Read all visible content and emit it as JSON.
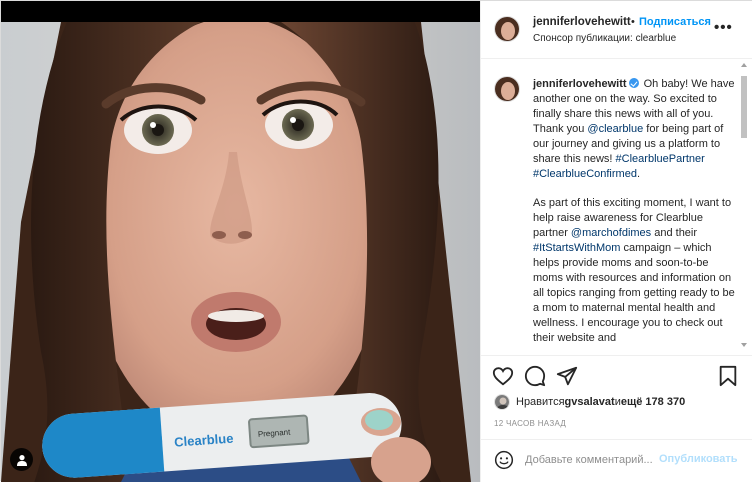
{
  "post": {
    "username": "jenniferlovehewitt",
    "follow_label": "Подписаться",
    "dot": "•",
    "sponsor_text": "Спонсор публикации: clearblue",
    "more": "•••",
    "photo": {
      "test_brand": "Clearblue",
      "test_result": "Pregnant"
    }
  },
  "caption": {
    "username": "jenniferlovehewitt",
    "part1": "Oh baby! We have another one on the way. So excited to finally share this news with all of you. Thank you ",
    "mention1": "@clearblue",
    "part2": " for being part of our journey and giving us a platform to share this news! ",
    "hashtag1": "#ClearbluePartner",
    "hashtag2": "#ClearblueConfirmed",
    "part3": ".",
    "p2_part1": "As part of this exciting moment, I want to help raise awareness for Clearblue partner ",
    "mention2": "@marchofdimes",
    "p2_part2": " and their ",
    "hashtag3": "#ItStartsWithMom",
    "p2_part3": " campaign – which helps provide moms and soon-to-be moms with resources and information on all topics ranging from getting ready to be a mom to maternal mental health and wellness. I encourage you to check out their website and"
  },
  "likes": {
    "prefix": "Нравится ",
    "user": "gvsalavat",
    "middle": " и ",
    "count": "ещё 178 370"
  },
  "time_label": "12 ЧАСОВ НАЗАД",
  "comment": {
    "placeholder": "Добавьте комментарий...",
    "publish_label": "Опубликовать"
  },
  "icons": {
    "like": "heart-icon",
    "comment": "comment-icon",
    "share": "paper-plane-icon",
    "save": "bookmark-icon",
    "emoji": "smiley-icon",
    "user_tag": "user-icon"
  },
  "colors": {
    "link_blue": "#0095f6",
    "mention_blue": "#00376b",
    "verified_blue": "#3897f0",
    "test_blue": "#1e88c8"
  }
}
